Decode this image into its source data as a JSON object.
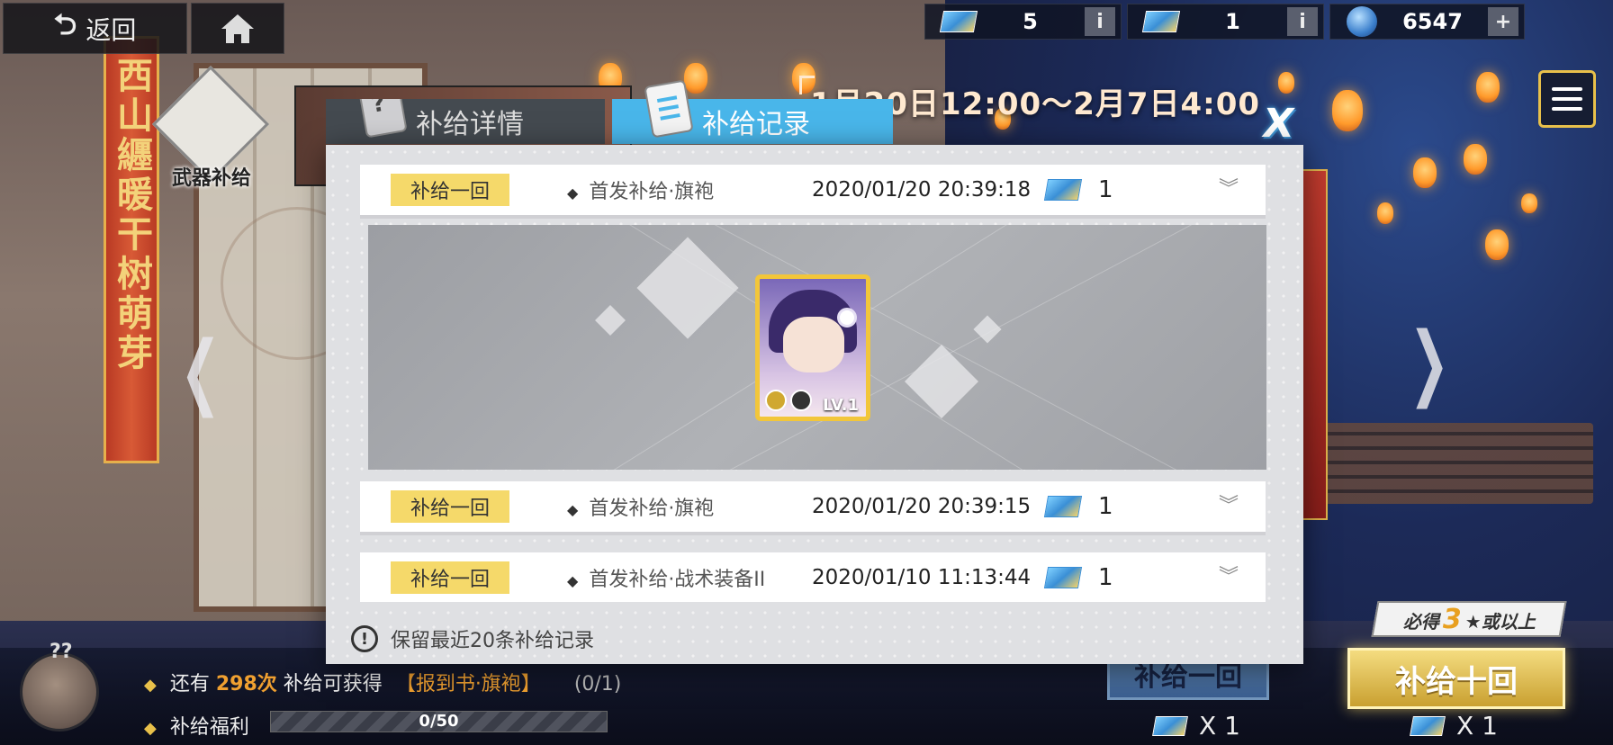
{
  "topbar": {
    "back_label": "返回",
    "currencies": [
      {
        "icon": "ticket-icon",
        "amount": "5",
        "side": "i"
      },
      {
        "icon": "ticket-icon",
        "amount": "1",
        "side": "i"
      },
      {
        "icon": "globe-icon",
        "amount": "6547",
        "side": "+"
      }
    ]
  },
  "event": {
    "time_range": "1月20日12:00～2月7日4:00",
    "banner_text": "西山纒暖干树萌芽"
  },
  "left": {
    "weapon_supply_label": "武器补给"
  },
  "modal": {
    "tab_details": "补给详情",
    "tab_record": "补给记录",
    "close_label": "X",
    "records": [
      {
        "tag": "补给一回",
        "name": "首发补给·旗袍",
        "time": "2020/01/20 20:39:18",
        "qty": "1"
      },
      {
        "tag": "补给一回",
        "name": "首发补给·旗袍",
        "time": "2020/01/20 20:39:15",
        "qty": "1"
      },
      {
        "tag": "补给一回",
        "name": "首发补给·战术装备II",
        "time": "2020/01/10 11:13:44",
        "qty": "1"
      }
    ],
    "result_level": "LV.1",
    "note": "保留最近20条补给记录"
  },
  "bottom": {
    "avatar_label": "??",
    "remain_prefix": "还有",
    "remain_count": "298次",
    "remain_suffix": "补给可获得",
    "remain_item": "【报到书·旗袍】",
    "remain_progress": "(0/1)",
    "welfare_label": "补给福利",
    "welfare_progress": "0/50",
    "welfare_fraction": 0,
    "pull_one_label": "补给一回",
    "pull_ten_label": "补给十回",
    "guarantee_prefix": "必得",
    "guarantee_num": "3",
    "guarantee_suffix": "★或以上",
    "cost_one": "X 1",
    "cost_ten": "X 1"
  },
  "colors": {
    "tab_active": "#49b6ea",
    "tag_yellow": "#f5d96a",
    "accent_gold": "#e8c04a"
  }
}
